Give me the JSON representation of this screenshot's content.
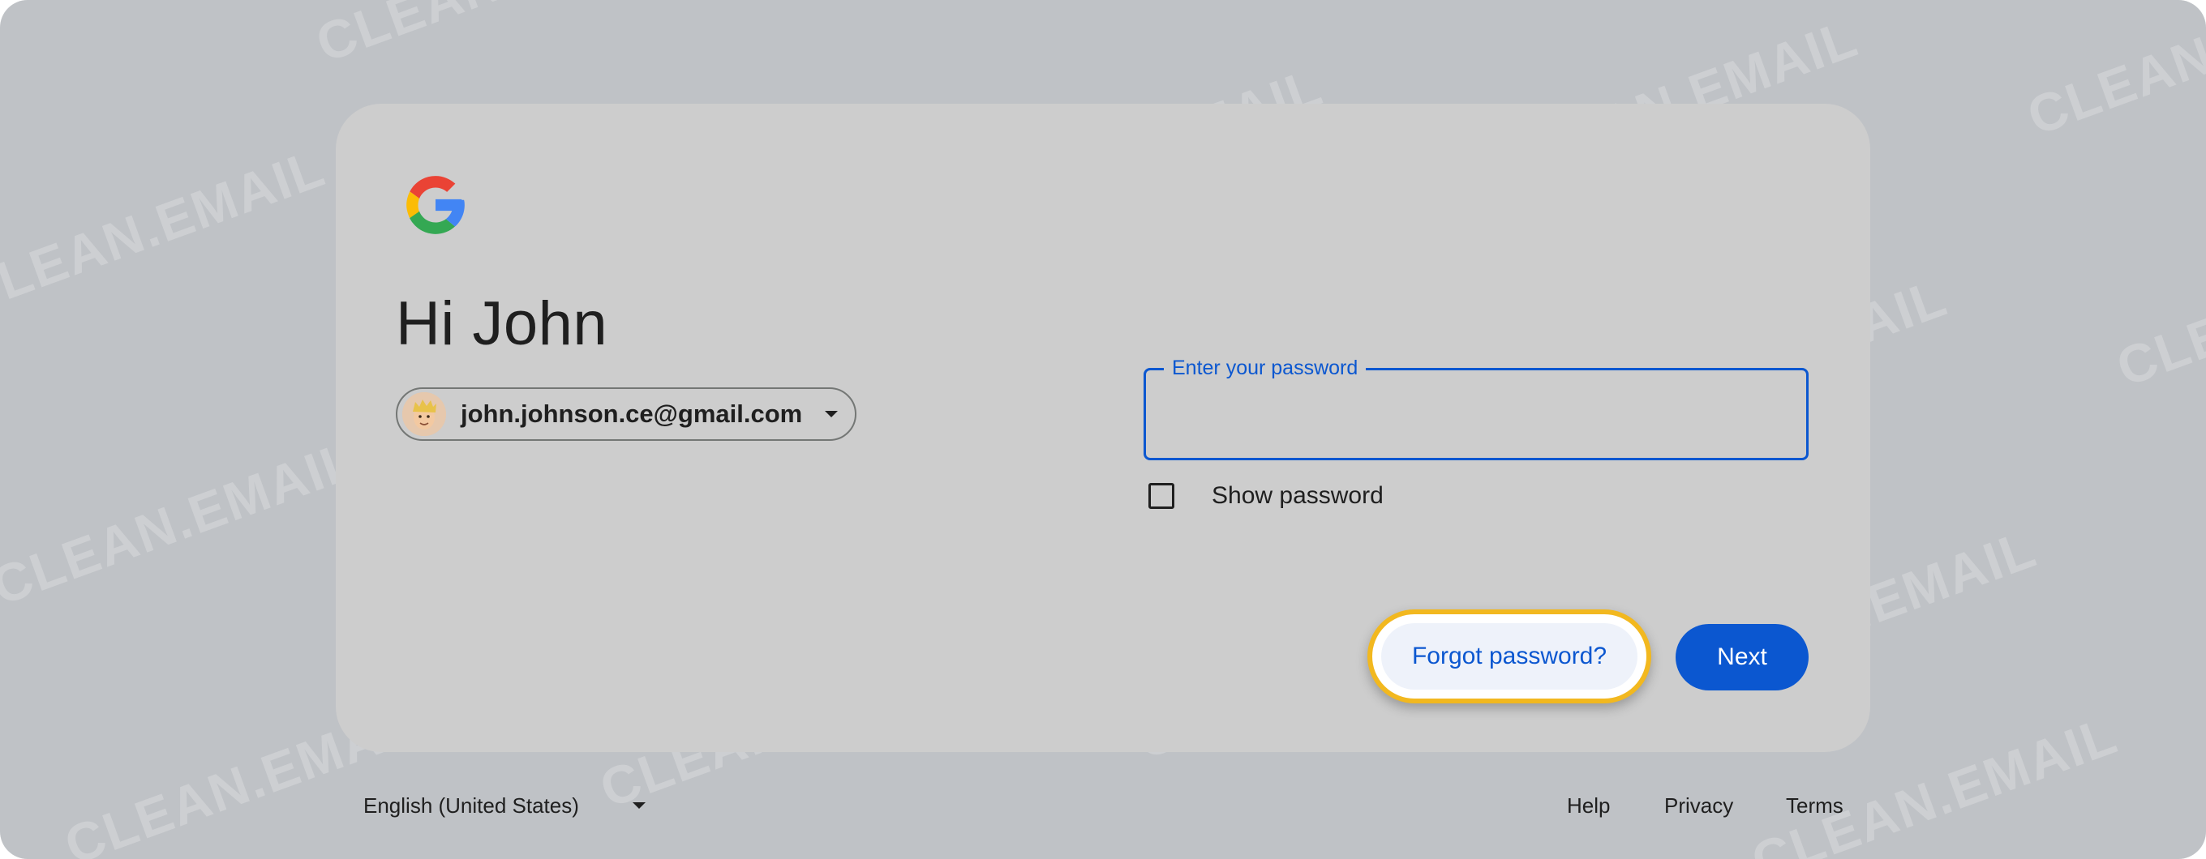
{
  "greeting": "Hi John",
  "account": {
    "email": "john.johnson.ce@gmail.com"
  },
  "password": {
    "label": "Enter your password",
    "value": ""
  },
  "show_password": {
    "label": "Show password",
    "checked": false
  },
  "actions": {
    "forgot_label": "Forgot password?",
    "next_label": "Next"
  },
  "footer": {
    "language": "English (United States)",
    "links": [
      "Help",
      "Privacy",
      "Terms"
    ]
  },
  "watermark": "CLEAN.EMAIL",
  "icons": {
    "logo": "google-g-icon",
    "avatar": "memoji-avatar",
    "chip_caret": "caret-down-icon",
    "footer_caret": "caret-down-icon"
  },
  "colors": {
    "accent": "#0b57d0",
    "highlight_ring": "#f2b81f",
    "backdrop": "#bfc2c6",
    "card": "#cdcdcd"
  }
}
